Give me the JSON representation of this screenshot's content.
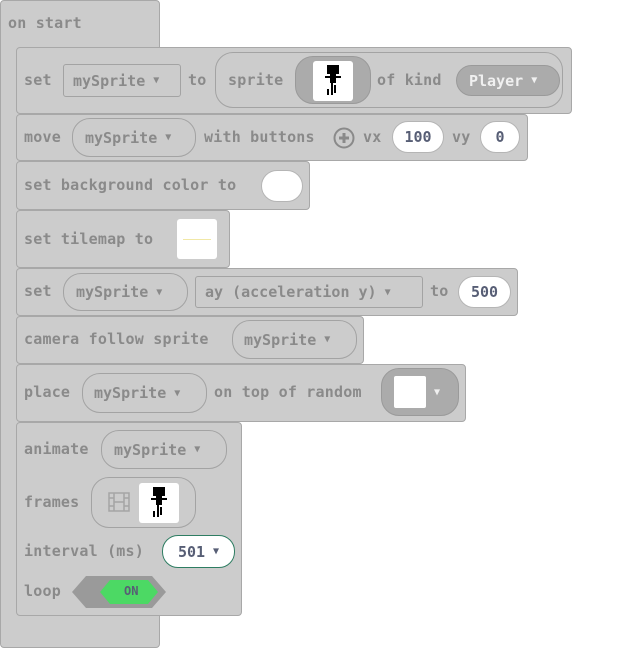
{
  "on_start": {
    "label": "on start"
  },
  "set_sprite": {
    "set_label": "set",
    "variable": "mySprite",
    "to_label": "to",
    "sprite_label": "sprite",
    "of_kind_label": "of kind",
    "kind": "Player"
  },
  "move": {
    "move_label": "move",
    "variable": "mySprite",
    "with_buttons_label": "with buttons",
    "vx_label": "vx",
    "vx_value": "100",
    "vy_label": "vy",
    "vy_value": "0"
  },
  "background": {
    "label": "set background color to"
  },
  "tilemap": {
    "label": "set tilemap to"
  },
  "set_accel": {
    "set_label": "set",
    "variable": "mySprite",
    "property": "ay (acceleration y)",
    "to_label": "to",
    "value": "500"
  },
  "camera": {
    "label": "camera follow sprite",
    "variable": "mySprite"
  },
  "place": {
    "place_label": "place",
    "variable": "mySprite",
    "on_top_label": "on top of random"
  },
  "animate": {
    "animate_label": "animate",
    "variable": "mySprite",
    "frames_label": "frames",
    "interval_label": "interval (ms)",
    "interval_value": "501",
    "loop_label": "loop",
    "loop_state": "ON"
  },
  "icons": [
    "plus-circle-icon",
    "film-strip-icon",
    "dropdown-arrow-icon"
  ],
  "colors": {
    "block": "#cccccc",
    "toggle_on": "#4cd964",
    "text": "#8a8a8a"
  }
}
